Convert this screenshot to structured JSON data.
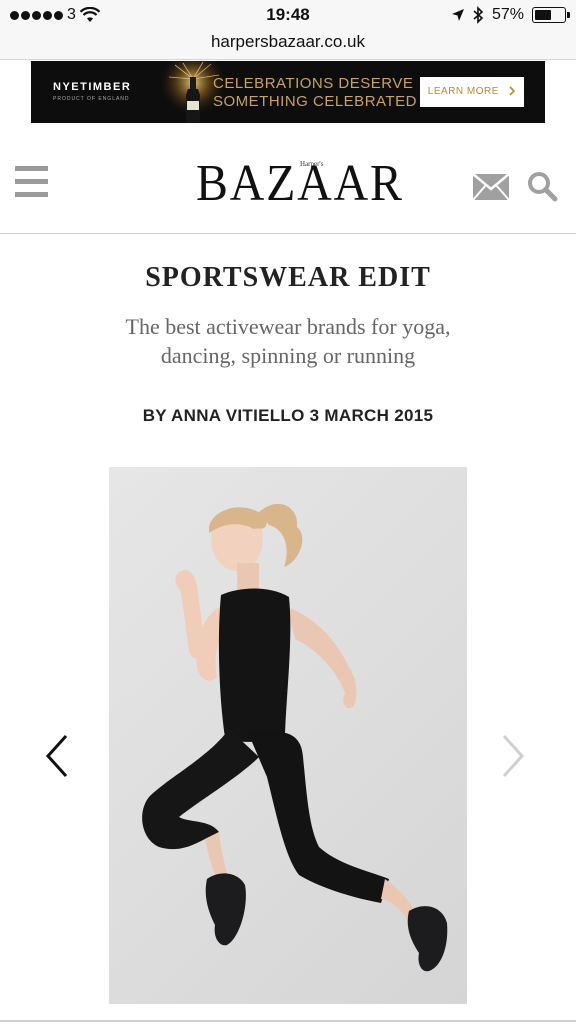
{
  "status_bar": {
    "carrier": "3",
    "time": "19:48",
    "battery": "57%",
    "battery_level": 0.57,
    "signal_icon": "signal-dots-icon",
    "wifi_icon": "wifi-icon",
    "location_icon": "location-arrow-icon",
    "bluetooth_icon": "bluetooth-icon",
    "battery_icon": "battery-icon"
  },
  "browser": {
    "url": "harpersbazaar.co.uk"
  },
  "ad": {
    "brand": "NYETIMBER",
    "brand_sub": "PRODUCT OF ENGLAND",
    "headline_line1": "CELEBRATIONS DESERVE",
    "headline_line2": "SOMETHING CELEBRATED",
    "cta": "LEARN MORE",
    "cta_icon": "chevron-right-icon",
    "headline_color": "#c8a45a"
  },
  "header": {
    "logo_small": "Harper's",
    "logo": "BAZAAR",
    "menu_icon": "hamburger-menu-icon",
    "mail_icon": "mail-icon",
    "search_icon": "search-icon"
  },
  "article": {
    "title": "SPORTSWEAR EDIT",
    "subtitle": "The best activewear brands for yoga, dancing, spinning or running",
    "byline": "BY ANNA VITIELLO 3 MARCH 2015"
  },
  "gallery": {
    "prev_icon": "chevron-left-icon",
    "next_icon": "chevron-right-icon"
  }
}
